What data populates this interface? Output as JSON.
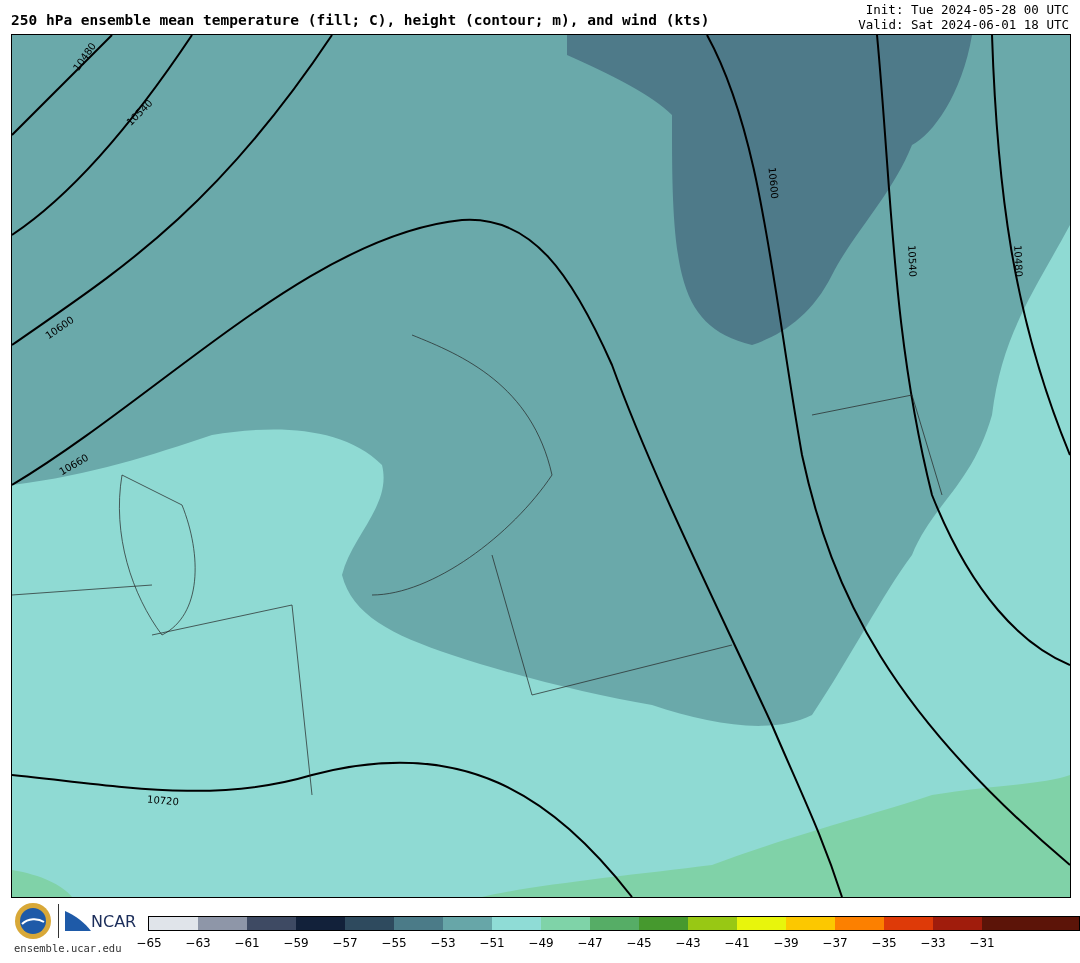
{
  "title": "250 hPa ensemble mean temperature (fill; C), height (contour; m), and wind (kts)",
  "init": "Init: Tue 2024-05-28 00 UTC",
  "valid": "Valid: Sat 2024-06-01 18 UTC",
  "map": {
    "contour_labels": [
      "10480",
      "10540",
      "10600",
      "10660",
      "10720",
      "10600",
      "10540",
      "10480"
    ]
  },
  "logo": {
    "wordmark": "NCAR",
    "site": "ensemble.ucar.edu"
  },
  "colorbar": [
    {
      "label": "−65",
      "color": "#e0e4ea"
    },
    {
      "label": "−63",
      "color": "#8e96a8"
    },
    {
      "label": "−61",
      "color": "#3e4a63"
    },
    {
      "label": "−59",
      "color": "#12213a"
    },
    {
      "label": "−57",
      "color": "#2e4a5e"
    },
    {
      "label": "−55",
      "color": "#4b7b88"
    },
    {
      "label": "−53",
      "color": "#67a6a8"
    },
    {
      "label": "−51",
      "color": "#8fdcd6"
    },
    {
      "label": "−49",
      "color": "#7fd3a8"
    },
    {
      "label": "−47",
      "color": "#56ad66"
    },
    {
      "label": "−45",
      "color": "#46992e"
    },
    {
      "label": "−43",
      "color": "#98c814"
    },
    {
      "label": "−41",
      "color": "#e8f50c"
    },
    {
      "label": "−39",
      "color": "#fcc800"
    },
    {
      "label": "−37",
      "color": "#fc8000"
    },
    {
      "label": "−35",
      "color": "#de3a08"
    },
    {
      "label": "−33",
      "color": "#a01c0c"
    },
    {
      "label": "−31",
      "color": "#5c1408"
    },
    {
      "color": "#5c1408"
    }
  ]
}
